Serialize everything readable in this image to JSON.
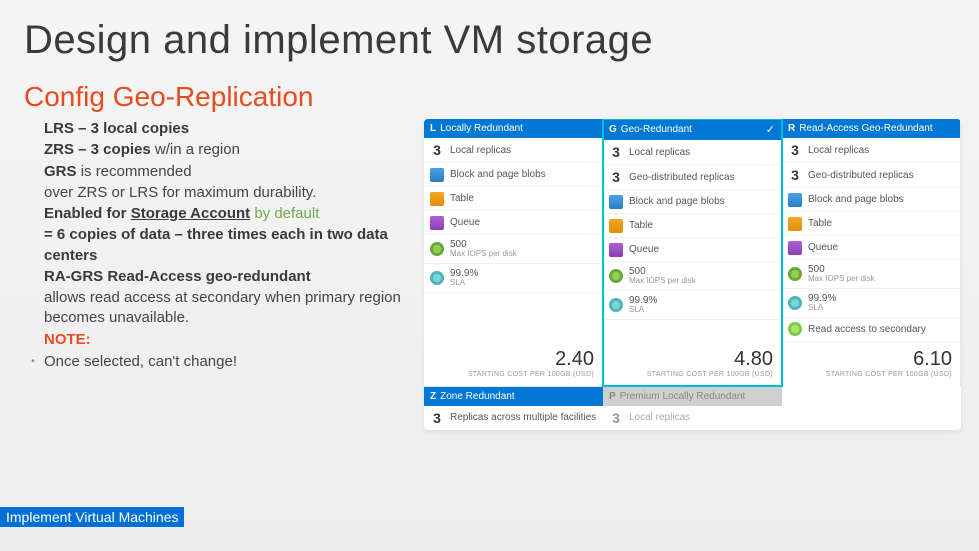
{
  "title": "Design and implement VM storage",
  "subtitle": "Config Geo-Replication",
  "bullets": {
    "lrs": "LRS – 3 local copies",
    "zrs_b": "ZRS – 3 copies ",
    "zrs_rest": "w/in a region",
    "grs_b": "GRS ",
    "grs_rest": "is recommended",
    "grs_line2": "over ZRS or LRS for maximum durability.",
    "enabled_b": "Enabled for ",
    "enabled_u": "Storage Account",
    "enabled_green": " by default",
    "copies": "= 6 copies of data – three times each in two data centers",
    "ragrs_b": "RA-GRS Read-Access geo-redundant",
    "ragrs_rest": "allows read access at secondary when primary region becomes unavailable.",
    "note_label": "NOTE:",
    "note_text": "Once selected, can't change!"
  },
  "footer": "Implement Virtual Machines",
  "cards": [
    {
      "code": "L",
      "name": "Locally Redundant",
      "highlight": false,
      "replicas": [
        {
          "n": "3",
          "label": "Local replicas"
        }
      ],
      "features": [
        "Block and page blobs",
        "Table",
        "Queue"
      ],
      "iops": {
        "n": "500",
        "label": "Max IOPS per disk"
      },
      "sla": {
        "n": "99.9%",
        "label": "SLA"
      },
      "price": "2.40",
      "price_label": "STARTING COST PER 100GB (USD)"
    },
    {
      "code": "G",
      "name": "Geo-Redundant",
      "highlight": true,
      "replicas": [
        {
          "n": "3",
          "label": "Local replicas"
        },
        {
          "n": "3",
          "label": "Geo-distributed replicas"
        }
      ],
      "features": [
        "Block and page blobs",
        "Table",
        "Queue"
      ],
      "iops": {
        "n": "500",
        "label": "Max IOPS per disk"
      },
      "sla": {
        "n": "99.9%",
        "label": "SLA"
      },
      "price": "4.80",
      "price_label": "STARTING COST PER 100GB (USD)"
    },
    {
      "code": "R",
      "name": "Read-Access Geo-Redundant",
      "highlight": false,
      "replicas": [
        {
          "n": "3",
          "label": "Local replicas"
        },
        {
          "n": "3",
          "label": "Geo-distributed replicas"
        }
      ],
      "features": [
        "Block and page blobs",
        "Table",
        "Queue"
      ],
      "iops": {
        "n": "500",
        "label": "Max IOPS per disk"
      },
      "sla": {
        "n": "99.9%",
        "label": "SLA"
      },
      "extra": "Read access to secondary",
      "price": "6.10",
      "price_label": "STARTING COST PER 100GB (USD)"
    }
  ],
  "bottom": [
    {
      "code": "Z",
      "name": "Zone Redundant",
      "n": "3",
      "label": "Replicas across multiple facilities",
      "grey": false
    },
    {
      "code": "P",
      "name": "Premium Locally Redundant",
      "n": "3",
      "label": "Local replicas",
      "grey": true
    }
  ]
}
